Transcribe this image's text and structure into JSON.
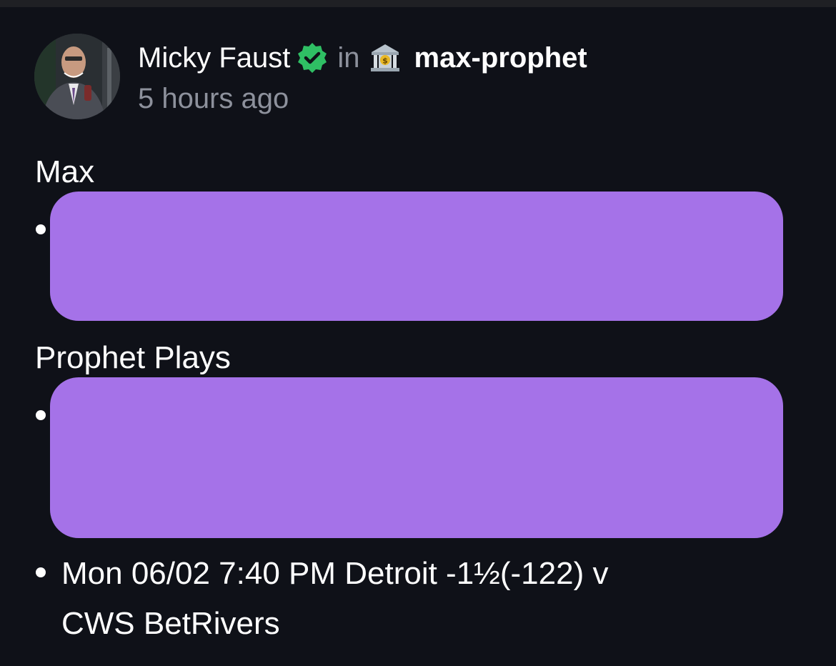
{
  "post": {
    "author": "Micky Faust",
    "in_label": "in",
    "channel": "max-prophet",
    "timestamp": "5 hours ago"
  },
  "icons": {
    "verified": "verified-badge-icon",
    "channel": "bank-icon",
    "avatar": "user-avatar-photo"
  },
  "colors": {
    "background": "#0f1118",
    "verified": "#2fbf64",
    "muted_text": "#8d919c",
    "redaction": "#a572e8"
  },
  "sections": {
    "max": {
      "title": "Max"
    },
    "prophet": {
      "title": "Prophet Plays",
      "play_line_1": "Mon 06/02 7:40 PM Detroit -1½(-122) v",
      "play_line_2": "CWS BetRivers"
    }
  }
}
